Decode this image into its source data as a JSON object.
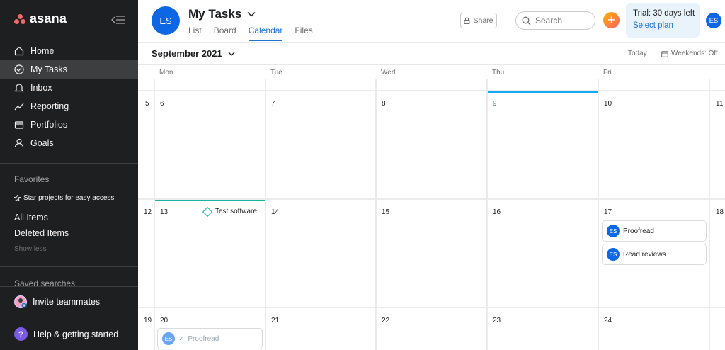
{
  "sidebar": {
    "brand": "asana",
    "nav": [
      {
        "label": "Home",
        "icon": "home-icon"
      },
      {
        "label": "My Tasks",
        "icon": "check-circle-icon",
        "active": true
      },
      {
        "label": "Inbox",
        "icon": "bell-icon"
      },
      {
        "label": "Reporting",
        "icon": "trend-icon"
      },
      {
        "label": "Portfolios",
        "icon": "portfolio-icon"
      },
      {
        "label": "Goals",
        "icon": "person-icon"
      }
    ],
    "favorites_title": "Favorites",
    "favorites_hint": "Star projects for easy access",
    "all_items": "All Items",
    "deleted_items": "Deleted Items",
    "show_less": "Show less",
    "saved_searches": "Saved searches",
    "invite": "Invite teammates",
    "help": "Help & getting started",
    "help_glyph": "?"
  },
  "header": {
    "avatar_initials": "ES",
    "title": "My Tasks",
    "tabs": [
      "List",
      "Board",
      "Calendar",
      "Files"
    ],
    "active_tab": "Calendar",
    "share_label": "Share",
    "search_placeholder": "Search",
    "add_glyph": "+",
    "trial_title": "Trial: 30 days left",
    "trial_link": "Select plan",
    "user_initials": "ES"
  },
  "calendar": {
    "month_label": "September 2021",
    "today_label": "Today",
    "weekends_label": "Weekends: Off",
    "days_of_week": [
      "Mon",
      "Tue",
      "Wed",
      "Thu",
      "Fri"
    ],
    "today_date": "9",
    "weeks": [
      {
        "week_num": "5",
        "dates": [
          "6",
          "7",
          "8",
          "9",
          "10"
        ],
        "next_num": "11"
      },
      {
        "week_num": "12",
        "dates": [
          "13",
          "14",
          "15",
          "16",
          "17"
        ],
        "next_num": "18"
      },
      {
        "week_num": "19",
        "dates": [
          "20",
          "21",
          "22",
          "23",
          "24"
        ],
        "next_num": ""
      }
    ],
    "tasks": {
      "test_software": "Test software",
      "proofread": "Proofread",
      "read_reviews": "Read reviews",
      "proofread_done": "Proofread",
      "assignee_initials": "ES",
      "done_check": "✓"
    },
    "colors": {
      "today_accent": "#14aaf5",
      "task_accent": "#13b5a0",
      "avatar": "#0d66e4"
    }
  }
}
